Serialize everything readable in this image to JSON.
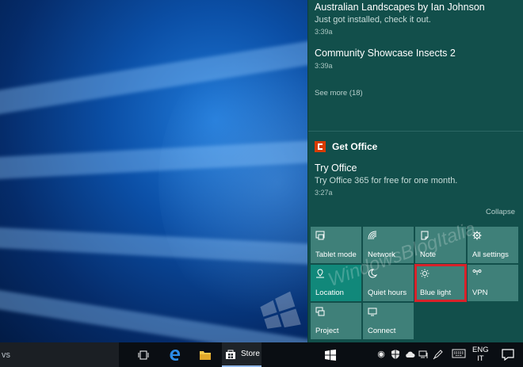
{
  "notifications": [
    {
      "title": "Australian Landscapes by Ian Johnson",
      "body": "Just got installed, check it out.",
      "time": "3:39a"
    },
    {
      "title": "Community Showcase Insects 2",
      "time": "3:39a"
    }
  ],
  "see_more": "See more (18)",
  "office": {
    "app_name": "Get Office",
    "title": "Try Office",
    "body": "Try Office 365 for free for one month.",
    "time": "3:27a"
  },
  "collapse": "Collapse",
  "quick_actions": [
    {
      "label": "Tablet mode",
      "icon": "tablet-mode-icon",
      "on": false
    },
    {
      "label": "Network",
      "icon": "network-icon",
      "on": false
    },
    {
      "label": "Note",
      "icon": "note-icon",
      "on": false
    },
    {
      "label": "All settings",
      "icon": "settings-icon",
      "on": false
    },
    {
      "label": "Location",
      "icon": "location-icon",
      "on": true
    },
    {
      "label": "Quiet hours",
      "icon": "moon-icon",
      "on": false
    },
    {
      "label": "Blue light",
      "icon": "sun-icon",
      "on": false,
      "highlighted": true
    },
    {
      "label": "VPN",
      "icon": "vpn-icon",
      "on": false
    },
    {
      "label": "Project",
      "icon": "project-icon",
      "on": false
    },
    {
      "label": "Connect",
      "icon": "connect-icon",
      "on": false
    }
  ],
  "watermark": "WindowsBlogItalia",
  "taskbar": {
    "search_fragment": "vs",
    "store_label": "Store",
    "language": {
      "line1": "ENG",
      "line2": "IT"
    }
  },
  "colors": {
    "panel": "#124f4b",
    "tile": "#3f8079",
    "tile_active": "#11887a",
    "highlight": "#d8222a",
    "taskbar": "#0a0e13",
    "office_red": "#d83b01"
  }
}
